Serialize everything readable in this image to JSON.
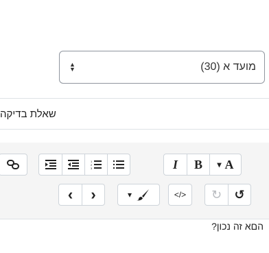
{
  "select": {
    "value": "מועד א (30)"
  },
  "textbox": {
    "value": "שאלת בדיקה"
  },
  "toolbar": {
    "row1": {
      "link_icon": "link-icon",
      "indent_icon": "indent-icon",
      "outdent_icon": "outdent-icon",
      "ordered_list_icon": "ordered-list-icon",
      "unordered_list_icon": "unordered-list-icon",
      "italic_label": "I",
      "bold_label": "B",
      "font_label": "A",
      "font_caret": "▾"
    },
    "row2": {
      "prev_label": "‹",
      "next_label": "›",
      "brush_caret": "▾",
      "html_label": "</>",
      "redo_label": "↻",
      "undo_label": "↺"
    }
  },
  "editor": {
    "content": "הםא זה נכון?"
  },
  "colors": {
    "border": "#ced4da",
    "toolbar_bg": "#f5f5f5",
    "select_border": "#8f959e"
  }
}
